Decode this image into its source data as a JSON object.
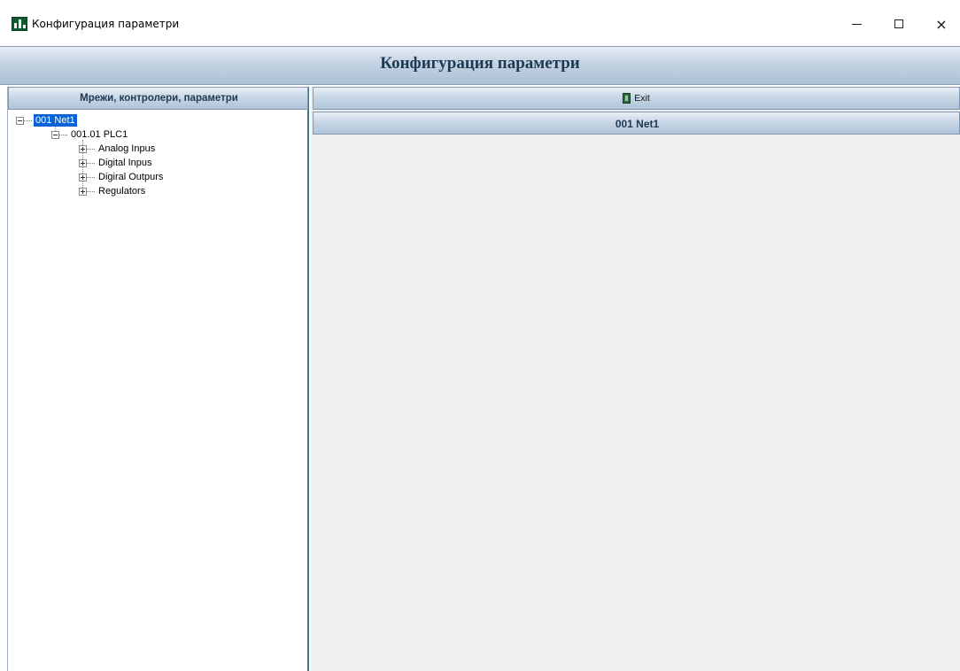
{
  "window": {
    "title": "Конфигурация параметри",
    "controls": {
      "minimize": "minimize-icon",
      "maximize": "maximize-icon",
      "close": "×"
    }
  },
  "banner": {
    "title": "Конфигурация параметри"
  },
  "left_panel": {
    "header": "Мрежи, контролери, параметри",
    "tree": {
      "root": {
        "label": "001  Net1",
        "expanded": true,
        "selected": true
      },
      "controller": {
        "label": "001.01  PLC1",
        "expanded": true
      },
      "groups": [
        {
          "label": "Analog Inpus",
          "expanded": false
        },
        {
          "label": "Digital Inpus",
          "expanded": false
        },
        {
          "label": "Digiral Outpurs",
          "expanded": false
        },
        {
          "label": "Regulators",
          "expanded": false
        }
      ]
    }
  },
  "right_panel": {
    "exit_button": {
      "label": "Exit",
      "icon": "exit-door-icon"
    },
    "net_header": "001  Net1"
  },
  "colors": {
    "accent_selected": "#0a64d8",
    "panel_header": "#c5d5e5",
    "header_text": "#203a52",
    "splitter": "#3f7390",
    "content_bg": "#efefef"
  }
}
